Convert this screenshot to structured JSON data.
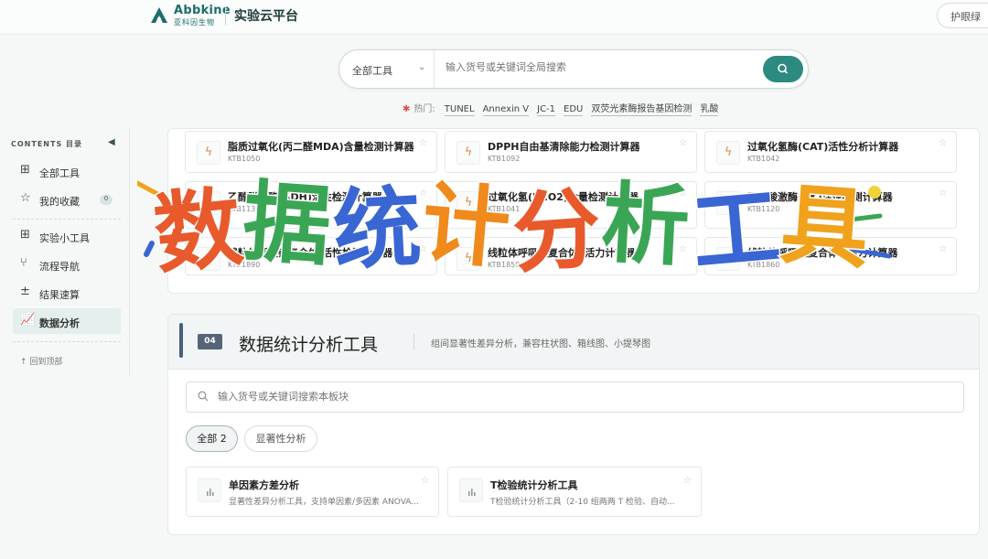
{
  "header": {
    "logo_name": "Abbkine",
    "logo_sub": "亚科因生物",
    "title": "实验云平台",
    "right_button": "护眼绿"
  },
  "search": {
    "scope": "全部工具",
    "placeholder": "输入货号或关键词全局搜索"
  },
  "hot": {
    "label": "热门:",
    "tags": [
      "TUNEL",
      "Annexin V",
      "JC-1",
      "EDU",
      "双荧光素酶报告基因检测",
      "乳酸"
    ]
  },
  "sidebar": {
    "header": "CONTENTS 目录",
    "items": [
      {
        "label": "全部工具",
        "icon": "grid-icon"
      },
      {
        "label": "我的收藏",
        "icon": "star-icon",
        "badge": "0"
      },
      {
        "label": "实验小工具",
        "icon": "apps-icon"
      },
      {
        "label": "流程导航",
        "icon": "flow-icon"
      },
      {
        "label": "结果速算",
        "icon": "calc-icon"
      },
      {
        "label": "数据分析",
        "icon": "chart-line-icon",
        "active": true
      }
    ],
    "back_top": "回到顶部"
  },
  "calc_cards": [
    {
      "title": "脂质过氧化(丙二醛MDA)含量检测计算器",
      "code": "KTB1050"
    },
    {
      "title": "DPPH自由基清除能力检测计算器",
      "code": "KTB1092"
    },
    {
      "title": "过氧化氢酶(CAT)活性分析计算器",
      "code": "KTB1042"
    },
    {
      "title": "乙醇脱氢酶(ADH)活性检测计算器",
      "code": "KTB1130"
    },
    {
      "title": "过氧化氢(H2O2)含量检测计算器",
      "code": "KTB1041"
    },
    {
      "title": "丙酮酸激酶(PK)活性检测计算器",
      "code": "KTB1120"
    },
    {
      "title": "线粒体呼吸链复合体Ⅰ活性检测计算器",
      "code": "KTB1890"
    },
    {
      "title": "线粒体呼吸链复合体Ⅱ活力计算器",
      "code": "KTB1850"
    },
    {
      "title": "线粒体呼吸链复合体Ⅲ活力计算器",
      "code": "KTB1860"
    }
  ],
  "section": {
    "number": "04",
    "title": "数据统计分析工具",
    "description": "组间显著性差异分析，兼容柱状图、箱线图、小提琴图",
    "search_placeholder": "输入货号或关键词搜索本板块",
    "filters": [
      "全部 2",
      "显著性分析"
    ],
    "tools": [
      {
        "title": "单因素方差分析",
        "desc": "显著性差异分析工具，支持单因素/多因素 ANOVA..."
      },
      {
        "title": "T检验统计分析工具",
        "desc": "T检验统计分析工具（2-10 组两两 T 检验、自动..."
      }
    ]
  },
  "banner": {
    "text": "数据统计分析工具",
    "colors": [
      "#e85a2c",
      "#3aa655",
      "#3a66d4",
      "#f08a1c",
      "#e85a2c",
      "#3aa655",
      "#3a66d4",
      "#f0a21c"
    ]
  }
}
